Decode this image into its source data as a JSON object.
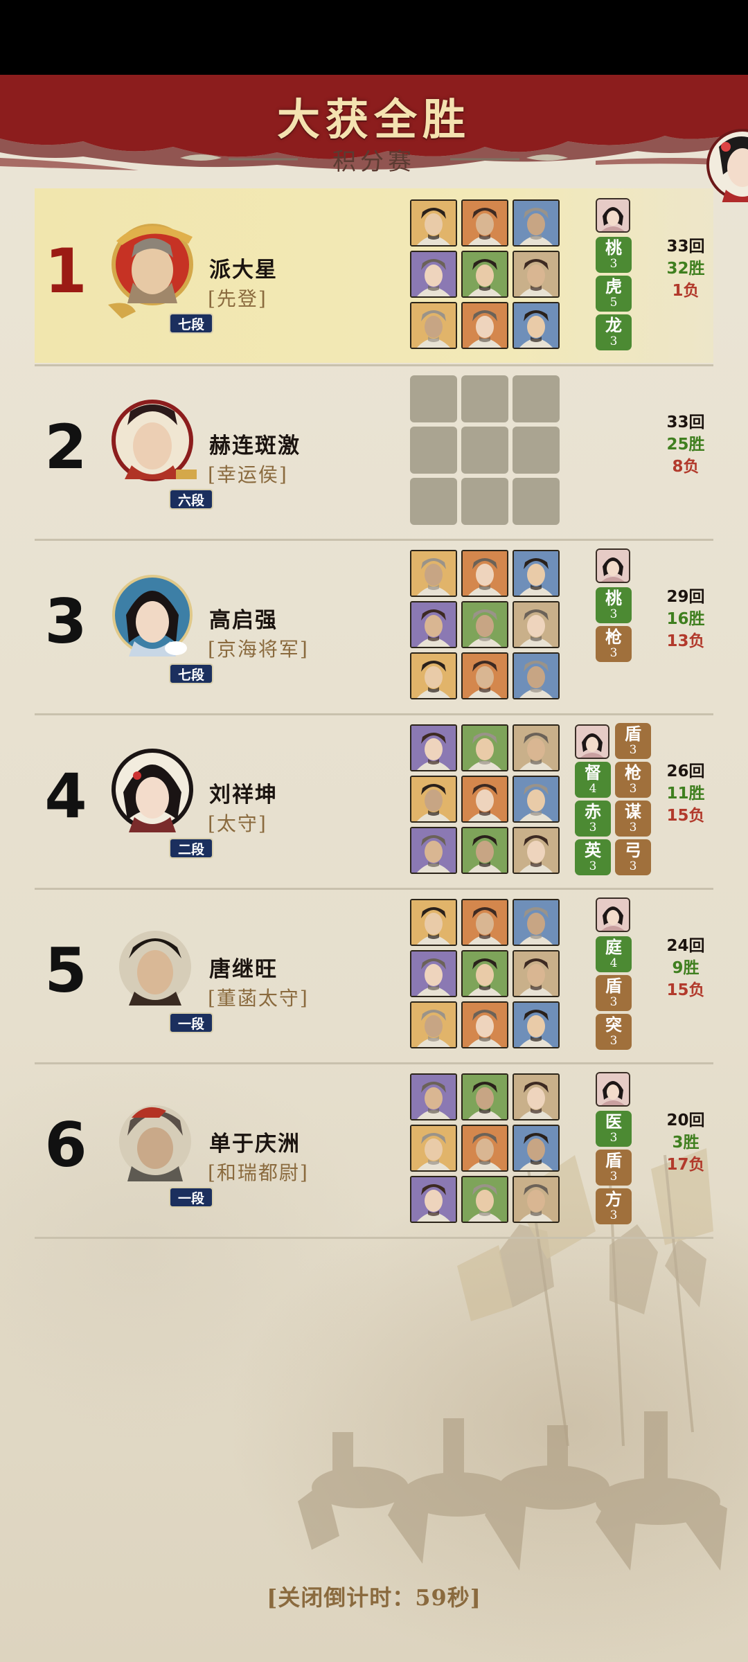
{
  "banner": {
    "title": "大获全胜",
    "subtitle": "积分赛"
  },
  "colors": {
    "banner_red": "#8c1d1d",
    "gold_rank": "#9b1b14",
    "win_green": "#3f7f1f",
    "loss_red": "#b23a2c",
    "tag_green": "#4c8a33",
    "tag_brown": "#a0703c"
  },
  "players": [
    {
      "rank": "1",
      "name": "派大星",
      "title": "[先登]",
      "level": "七段",
      "rounds": "33回",
      "wins": "32胜",
      "losses": "1负",
      "lineup": [
        "hero",
        "hero",
        "hero",
        "hero",
        "hero",
        "hero",
        "hero",
        "hero",
        "hero"
      ],
      "tags": [
        {
          "name": "桃",
          "count": "3",
          "color": "green"
        },
        {
          "name": "虎",
          "count": "5",
          "color": "green"
        },
        {
          "name": "龙",
          "count": "3",
          "color": "green"
        }
      ]
    },
    {
      "rank": "2",
      "name": "赫连斑激",
      "title": "[幸运侯]",
      "level": "六段",
      "rounds": "33回",
      "wins": "25胜",
      "losses": "8负",
      "lineup": [],
      "tags": []
    },
    {
      "rank": "3",
      "name": "高启强",
      "title": "[京海将军]",
      "level": "七段",
      "rounds": "29回",
      "wins": "16胜",
      "losses": "13负",
      "lineup": [
        "hero",
        "hero",
        "hero",
        "hero",
        "hero",
        "hero",
        "hero",
        "hero",
        "hero"
      ],
      "tags": [
        {
          "name": "桃",
          "count": "3",
          "color": "green"
        },
        {
          "name": "枪",
          "count": "3",
          "color": "brown"
        }
      ]
    },
    {
      "rank": "4",
      "name": "刘祥坤",
      "title": "[太守]",
      "level": "二段",
      "rounds": "26回",
      "wins": "11胜",
      "losses": "15负",
      "lineup": [
        "hero",
        "hero",
        "hero",
        "hero",
        "hero",
        "hero",
        "hero",
        "hero",
        "hero"
      ],
      "tags": [
        {
          "name": "督",
          "count": "4",
          "color": "green"
        },
        {
          "name": "赤",
          "count": "3",
          "color": "green"
        },
        {
          "name": "英",
          "count": "3",
          "color": "green"
        },
        {
          "name": "盾",
          "count": "3",
          "color": "brown"
        },
        {
          "name": "枪",
          "count": "3",
          "color": "brown"
        },
        {
          "name": "谋",
          "count": "3",
          "color": "brown"
        },
        {
          "name": "弓",
          "count": "3",
          "color": "brown"
        }
      ]
    },
    {
      "rank": "5",
      "name": "唐继旺",
      "title": "[董菡太守]",
      "level": "一段",
      "rounds": "24回",
      "wins": "9胜",
      "losses": "15负",
      "lineup": [
        "hero",
        "hero",
        "hero",
        "hero",
        "hero",
        "hero",
        "hero",
        "hero",
        "hero"
      ],
      "tags": [
        {
          "name": "庭",
          "count": "4",
          "color": "green"
        },
        {
          "name": "盾",
          "count": "3",
          "color": "brown"
        },
        {
          "name": "突",
          "count": "3",
          "color": "brown"
        }
      ]
    },
    {
      "rank": "6",
      "name": "单于庆洲",
      "title": "[和瑞都尉]",
      "level": "一段",
      "rounds": "20回",
      "wins": "3胜",
      "losses": "17负",
      "lineup": [
        "hero",
        "hero",
        "hero",
        "hero",
        "hero",
        "hero",
        "hero",
        "hero",
        "hero"
      ],
      "tags": [
        {
          "name": "医",
          "count": "3",
          "color": "green"
        },
        {
          "name": "盾",
          "count": "3",
          "color": "brown"
        },
        {
          "name": "方",
          "count": "3",
          "color": "brown"
        }
      ]
    }
  ],
  "footer": {
    "countdown": "[关闭倒计时：59秒]"
  }
}
